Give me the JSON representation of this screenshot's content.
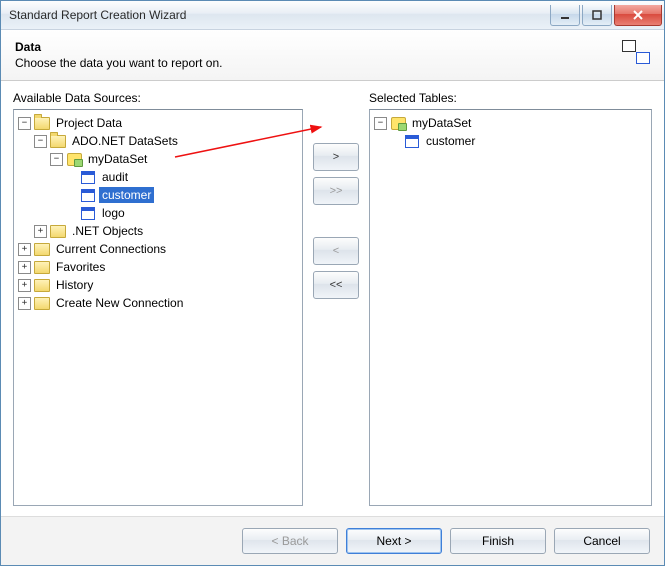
{
  "window": {
    "title": "Standard Report Creation Wizard"
  },
  "header": {
    "title": "Data",
    "subtitle": "Choose the data you want to report on."
  },
  "labels": {
    "available": "Available Data Sources:",
    "selected": "Selected Tables:"
  },
  "buttons": {
    "add": ">",
    "add_all": ">>",
    "remove": "<",
    "remove_all": "<<",
    "back": "< Back",
    "next": "Next >",
    "finish": "Finish",
    "cancel": "Cancel"
  },
  "tree_left": {
    "root": "Project Data",
    "n0": "ADO.NET DataSets",
    "n00": "myDataSet",
    "n000": "audit",
    "n001": "customer",
    "n002": "logo",
    "n1": ".NET Objects",
    "r1": "Current Connections",
    "r2": "Favorites",
    "r3": "History",
    "r4": "Create New Connection"
  },
  "tree_right": {
    "root": "myDataSet",
    "n0": "customer"
  }
}
